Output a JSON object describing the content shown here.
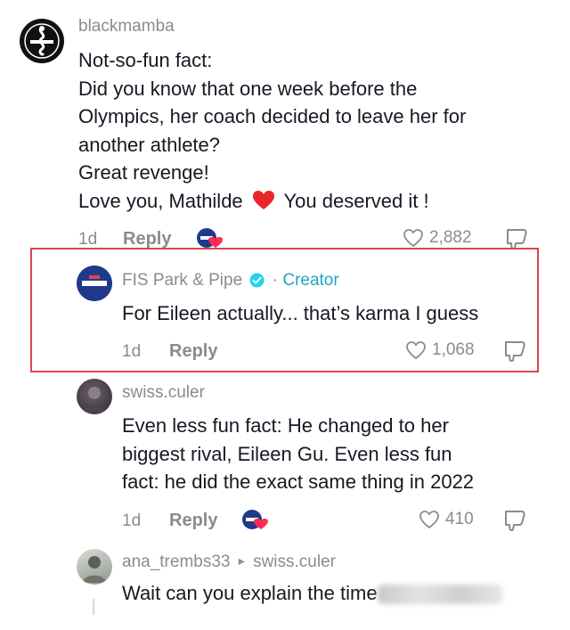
{
  "comments": [
    {
      "username": "blackmamba",
      "lines": [
        "Not-so-fun fact:",
        "Did you know that one week before the",
        "Olympics, her coach decided to leave her for",
        "another athlete?",
        "Great revenge!",
        "Love you, Mathilde",
        "You deserved it !"
      ],
      "time": "1d",
      "reply": "Reply",
      "likes": "2,882"
    },
    {
      "username": "FIS Park & Pipe",
      "separator": "·",
      "creator_label": "Creator",
      "text": "For Eileen actually... that’s karma I guess",
      "time": "1d",
      "reply": "Reply",
      "likes": "1,068"
    },
    {
      "username": "swiss.culer",
      "lines": [
        "Even less fun fact: He changed to her",
        "biggest rival, Eileen Gu. Even less fun",
        "fact: he did the exact same thing in 2022"
      ],
      "time": "1d",
      "reply": "Reply",
      "likes": "410"
    },
    {
      "username": "ana_trembs33",
      "reply_arrow": "▸",
      "reply_to": "swiss.culer",
      "text": "Wait can you explain the time"
    }
  ],
  "colors": {
    "highlight_border": "#e0444d",
    "creator": "#20a5c7",
    "meta_gray": "#8a8b91"
  }
}
